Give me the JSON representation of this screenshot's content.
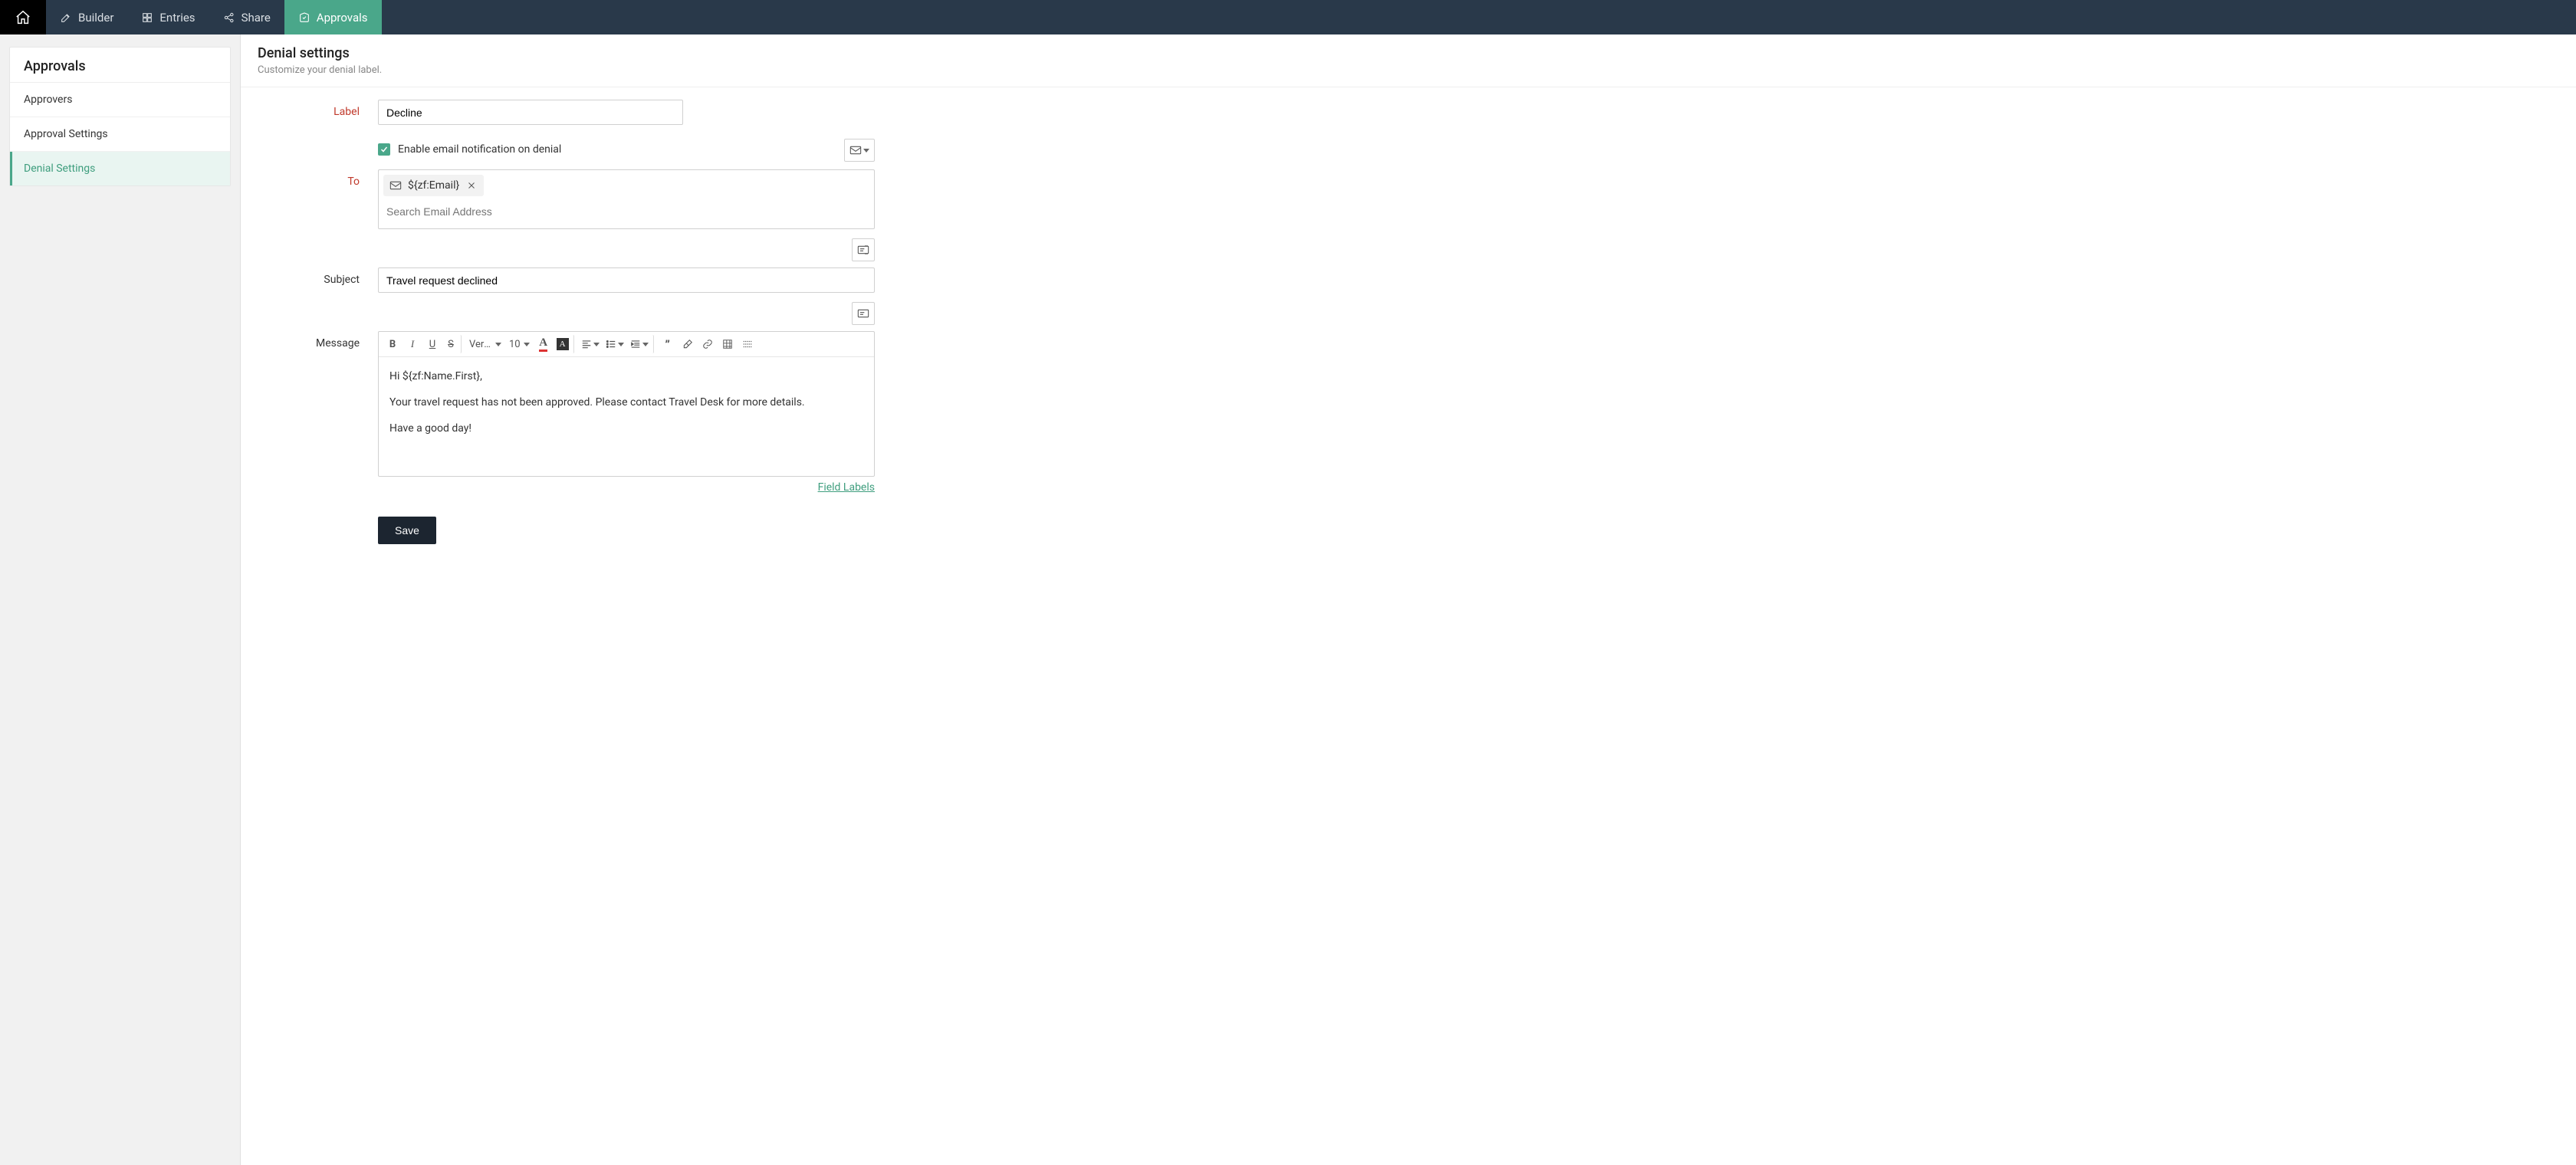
{
  "nav": {
    "tabs": [
      {
        "id": "builder",
        "label": "Builder",
        "active": false
      },
      {
        "id": "entries",
        "label": "Entries",
        "active": false
      },
      {
        "id": "share",
        "label": "Share",
        "active": false
      },
      {
        "id": "approvals",
        "label": "Approvals",
        "active": true
      }
    ]
  },
  "sidebar": {
    "title": "Approvals",
    "items": [
      {
        "id": "approvers",
        "label": "Approvers",
        "active": false
      },
      {
        "id": "approval-settings",
        "label": "Approval Settings",
        "active": false
      },
      {
        "id": "denial-settings",
        "label": "Denial Settings",
        "active": true
      }
    ]
  },
  "page": {
    "title": "Denial settings",
    "subtitle": "Customize your denial label."
  },
  "form": {
    "label_label": "Label",
    "label_value": "Decline",
    "enable_email_label": "Enable email notification on denial",
    "enable_email_checked": true,
    "to_label": "To",
    "to_chip": "${zf:Email}",
    "to_search_placeholder": "Search Email Address",
    "subject_label": "Subject",
    "subject_value": "Travel request declined",
    "message_label": "Message",
    "font_family": "Verdana",
    "font_size": "10",
    "message_lines": [
      "Hi ${zf:Name.First},",
      "Your travel request has not been approved. Please contact Travel Desk for more details.",
      "Have a good day!"
    ],
    "field_labels_link": "Field Labels",
    "save_label": "Save"
  },
  "colors": {
    "nav_bg": "#29394a",
    "accent": "#4aa78a",
    "required": "#c0392b"
  }
}
